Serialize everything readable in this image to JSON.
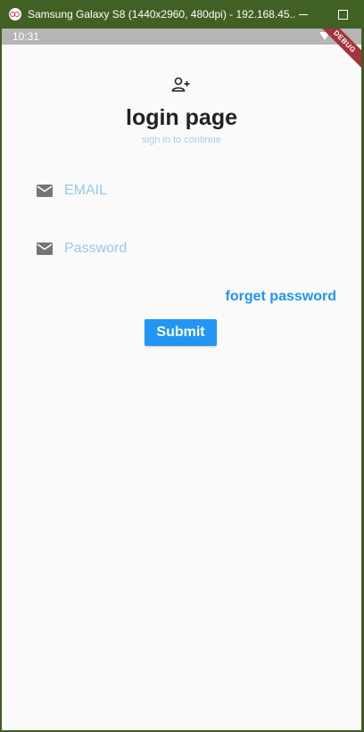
{
  "window": {
    "title": "Samsung Galaxy S8 (1440x2960, 480dpi) - 192.168.45..."
  },
  "statusbar": {
    "time": "10:31",
    "debug_banner": "DEBUG"
  },
  "header": {
    "icon": "person-add-icon",
    "title": "login page",
    "subtitle": "sign in to continue"
  },
  "form": {
    "email_placeholder": "EMAIL",
    "password_placeholder": "Password",
    "field_icon": "mail-icon",
    "forget_label": "forget password",
    "submit_label": "Submit"
  },
  "colors": {
    "accent": "#2196f3",
    "placeholder": "#9cc7e8",
    "title": "#222222",
    "icon": "#757575"
  }
}
